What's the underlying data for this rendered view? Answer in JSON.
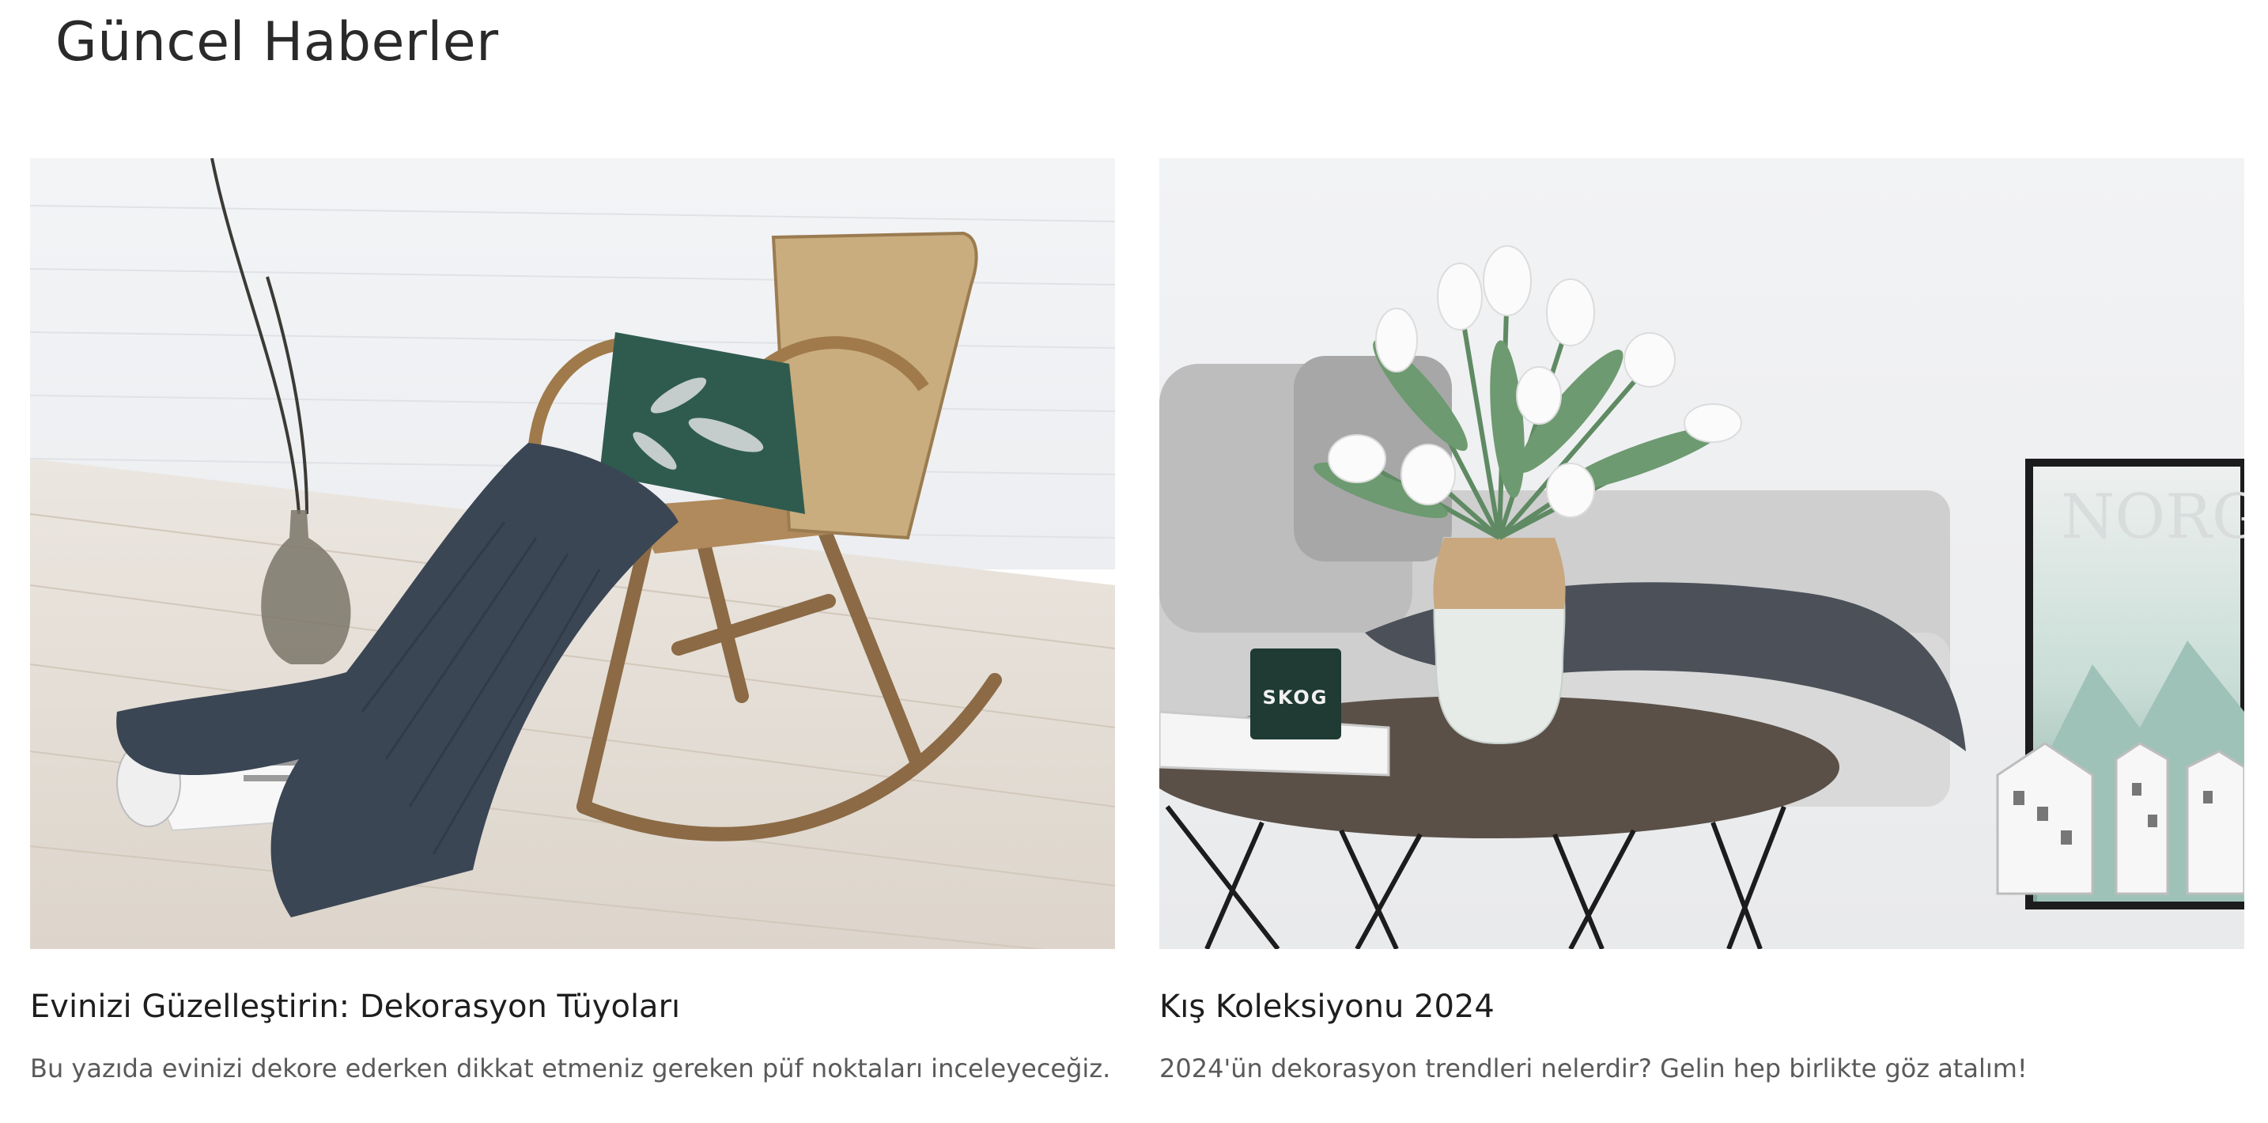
{
  "page": {
    "title": "Güncel Haberler"
  },
  "articles": [
    {
      "title": "Evinizi Güzelleştirin: Dekorasyon Tüyoları",
      "description": "Bu yazıda evinizi dekore ederken dikkat etmeniz gereken püf noktaları inceleyeceğiz.",
      "image_alt": "rocking chair with blanket and vase"
    },
    {
      "title": "Kış Koleksiyonu 2024",
      "description": "2024'ün dekorasyon trendleri nelerdir? Gelin hep birlikte göz atalım!",
      "image_alt": "living room with tulips on coffee table",
      "candle_label": "SKOG",
      "poster_label": "NORG"
    }
  ]
}
